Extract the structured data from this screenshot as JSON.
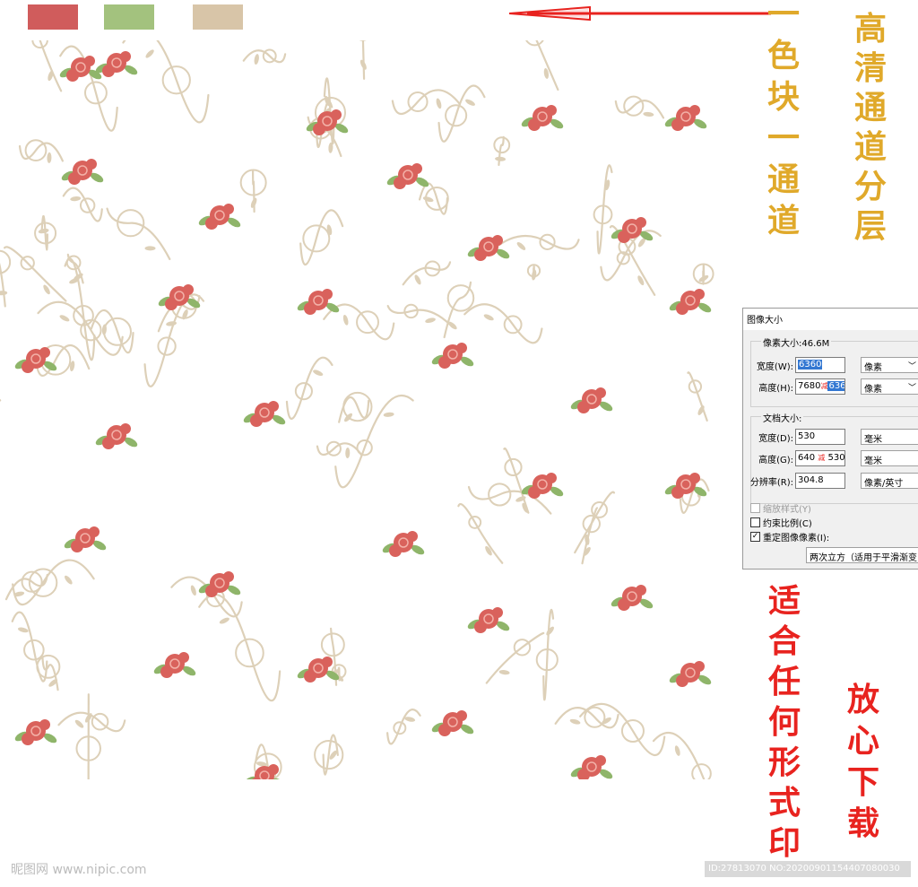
{
  "swatches": {
    "colors": [
      "#d05c5c",
      "#a3c27e",
      "#d8c5a8"
    ]
  },
  "annotations": {
    "channel_note": [
      "一",
      "色",
      "块",
      "一",
      "通",
      "道"
    ],
    "hd_note": [
      "高",
      "清",
      "通",
      "道",
      "分",
      "层"
    ],
    "print_note": [
      "适",
      "合",
      "任",
      "何",
      "形",
      "式",
      "印"
    ],
    "download_note": [
      "放",
      "心",
      "下",
      "载"
    ],
    "channel_color": "#e0a92a",
    "print_color": "#e8231f"
  },
  "pattern": {
    "rose_color": "#d9625c",
    "leaf_color": "#8fb56a",
    "vine_color": "#ddd0b8"
  },
  "dialog": {
    "title": "图像大小",
    "pixel_dims_label": "像素大小:46.6M",
    "width_label": "宽度(W):",
    "width_value": "6360",
    "width_unit": "像素",
    "height_label": "高度(H):",
    "height_value_old": "7680",
    "height_strike": "减",
    "height_value": "6360",
    "height_unit": "像素",
    "doc_size_label": "文档大小:",
    "doc_width_label": "宽度(D):",
    "doc_width_value": "530",
    "doc_width_unit": "毫米",
    "doc_height_label": "高度(G):",
    "doc_height_value": "640",
    "doc_height_strike": "减",
    "doc_height_new": "530",
    "doc_height_unit": "毫米",
    "resolution_label": "分辨率(R):",
    "resolution_value": "304.8",
    "resolution_unit": "像素/英寸",
    "scale_styles": "缩放样式(Y)",
    "constrain": "约束比例(C)",
    "resample": "重定图像像素(I):",
    "resample_method": "两次立方（适用于平滑渐变"
  },
  "footer": {
    "watermark": "昵图网 www.nipic.com",
    "id_text": "ID:27813070 NO:20200901154407080030"
  }
}
